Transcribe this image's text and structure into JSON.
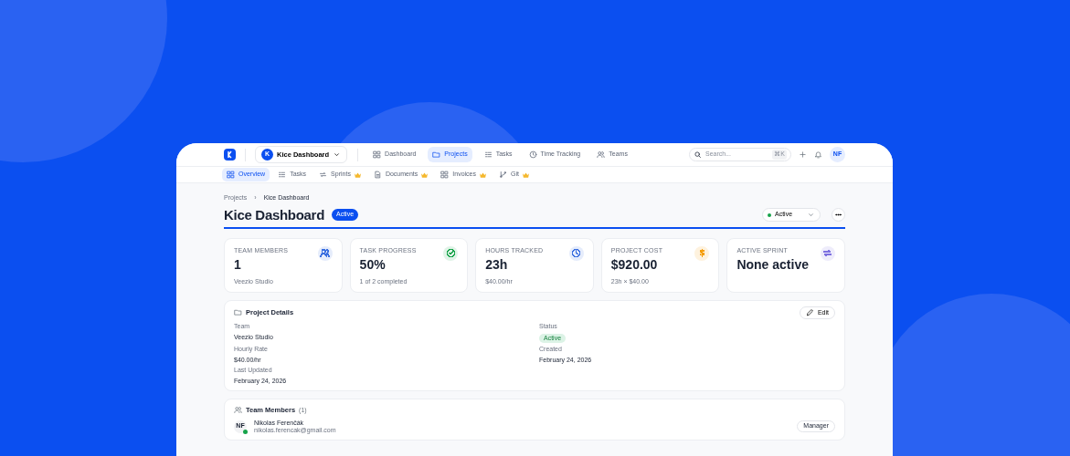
{
  "topbar": {
    "project": {
      "initials": "K",
      "name": "Kice Dashboard"
    },
    "nav": [
      {
        "label": "Dashboard",
        "selected": false
      },
      {
        "label": "Projects",
        "selected": true
      },
      {
        "label": "Tasks",
        "selected": false
      },
      {
        "label": "Time Tracking",
        "selected": false
      },
      {
        "label": "Teams",
        "selected": false
      }
    ],
    "search": {
      "placeholder": "Search...",
      "shortcut": "⌘K"
    },
    "avatar": "NF"
  },
  "subnav": [
    {
      "label": "Overview",
      "selected": true,
      "premium": false
    },
    {
      "label": "Tasks",
      "selected": false,
      "premium": false
    },
    {
      "label": "Sprints",
      "selected": false,
      "premium": true
    },
    {
      "label": "Documents",
      "selected": false,
      "premium": true
    },
    {
      "label": "Invoices",
      "selected": false,
      "premium": true
    },
    {
      "label": "Git",
      "selected": false,
      "premium": true
    }
  ],
  "breadcrumb": {
    "items": [
      "Projects",
      "Kice Dashboard"
    ],
    "separator": "›"
  },
  "title": "Kice Dashboard",
  "title_badge": "Active",
  "status_select": {
    "value": "Active"
  },
  "stats": [
    {
      "label": "TEAM MEMBERS",
      "value": "1",
      "sub": "Veezio Studio",
      "color": "#3b6fe0"
    },
    {
      "label": "TASK PROGRESS",
      "value": "50%",
      "sub": "1 of 2 completed",
      "color": "#16a34a"
    },
    {
      "label": "HOURS TRACKED",
      "value": "23h",
      "sub": "$40.00/hr",
      "color": "#3b6fe0"
    },
    {
      "label": "PROJECT COST",
      "value": "$920.00",
      "sub": "23h × $40.00",
      "color": "#f59e0b"
    },
    {
      "label": "ACTIVE SPRINT",
      "value": "None active",
      "color": "#7c6fe0"
    }
  ],
  "details": {
    "title": "Project Details",
    "edit": "Edit",
    "fields": [
      {
        "label": "Team",
        "value": "Veezio Studio",
        "kind": "text"
      },
      {
        "label": "Status",
        "value": "Active",
        "kind": "badge"
      },
      {
        "label": "Hourly Rate",
        "value": "$40.00/hr",
        "kind": "text"
      },
      {
        "label": "Created",
        "value": "February 24, 2026",
        "kind": "text"
      },
      {
        "label": "Last Updated",
        "value": "February 24, 2026",
        "kind": "text"
      }
    ]
  },
  "team": {
    "title": "Team Members",
    "count": "(1)",
    "members": [
      {
        "initials": "NF",
        "name": "Nikolas Ferenčák",
        "email": "nikolas.ferencak@gmail.com",
        "role": "Manager",
        "online": true
      }
    ]
  }
}
